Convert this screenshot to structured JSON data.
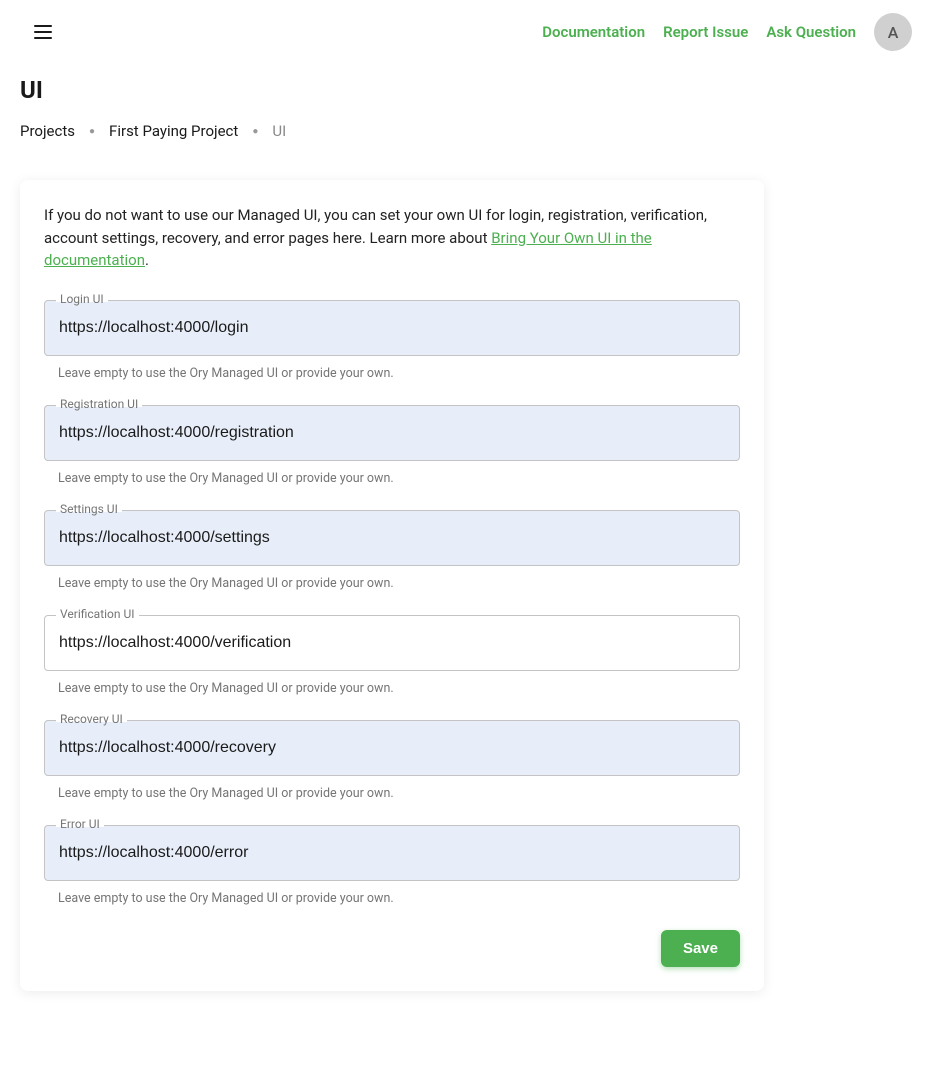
{
  "header": {
    "links": {
      "documentation": "Documentation",
      "report_issue": "Report Issue",
      "ask_question": "Ask Question"
    },
    "avatar_initial": "A"
  },
  "page": {
    "title": "UI"
  },
  "breadcrumb": {
    "projects": "Projects",
    "project_name": "First Paying Project",
    "current": "UI"
  },
  "intro": {
    "text_before": "If you do not want to use our Managed UI, you can set your own UI for login, registration, verification, account settings, recovery, and error pages here. Learn more about ",
    "link_text": "Bring Your Own UI in the documentation",
    "text_after": "."
  },
  "fields": {
    "login": {
      "label": "Login UI",
      "value": "https://localhost:4000/login",
      "helper": "Leave empty to use the Ory Managed UI or provide your own.",
      "tinted": true
    },
    "registration": {
      "label": "Registration UI",
      "value": "https://localhost:4000/registration",
      "helper": "Leave empty to use the Ory Managed UI or provide your own.",
      "tinted": true
    },
    "settings": {
      "label": "Settings UI",
      "value": "https://localhost:4000/settings",
      "helper": "Leave empty to use the Ory Managed UI or provide your own.",
      "tinted": true
    },
    "verification": {
      "label": "Verification UI",
      "value": "https://localhost:4000/verification",
      "helper": "Leave empty to use the Ory Managed UI or provide your own.",
      "tinted": false
    },
    "recovery": {
      "label": "Recovery UI",
      "value": "https://localhost:4000/recovery",
      "helper": "Leave empty to use the Ory Managed UI or provide your own.",
      "tinted": true
    },
    "error": {
      "label": "Error UI",
      "value": "https://localhost:4000/error",
      "helper": "Leave empty to use the Ory Managed UI or provide your own.",
      "tinted": true
    }
  },
  "actions": {
    "save": "Save"
  }
}
